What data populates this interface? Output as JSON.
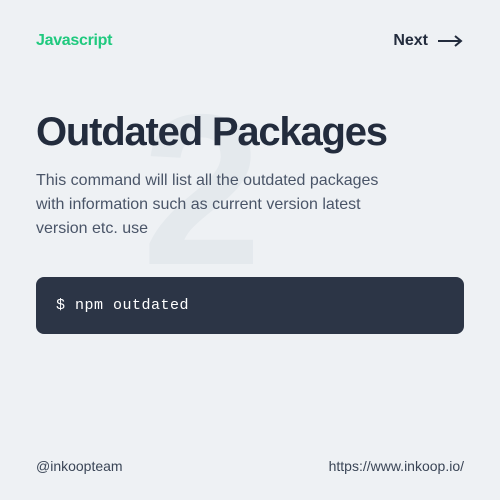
{
  "header": {
    "category": "Javascript",
    "next_label": "Next"
  },
  "content": {
    "bg_number": "2",
    "title": "Outdated Packages",
    "description": "This command will list all the outdated packages with information such as current version latest version etc. use",
    "code": "$ npm outdated"
  },
  "footer": {
    "handle": "@inkoopteam",
    "url": "https://www.inkoop.io/"
  }
}
